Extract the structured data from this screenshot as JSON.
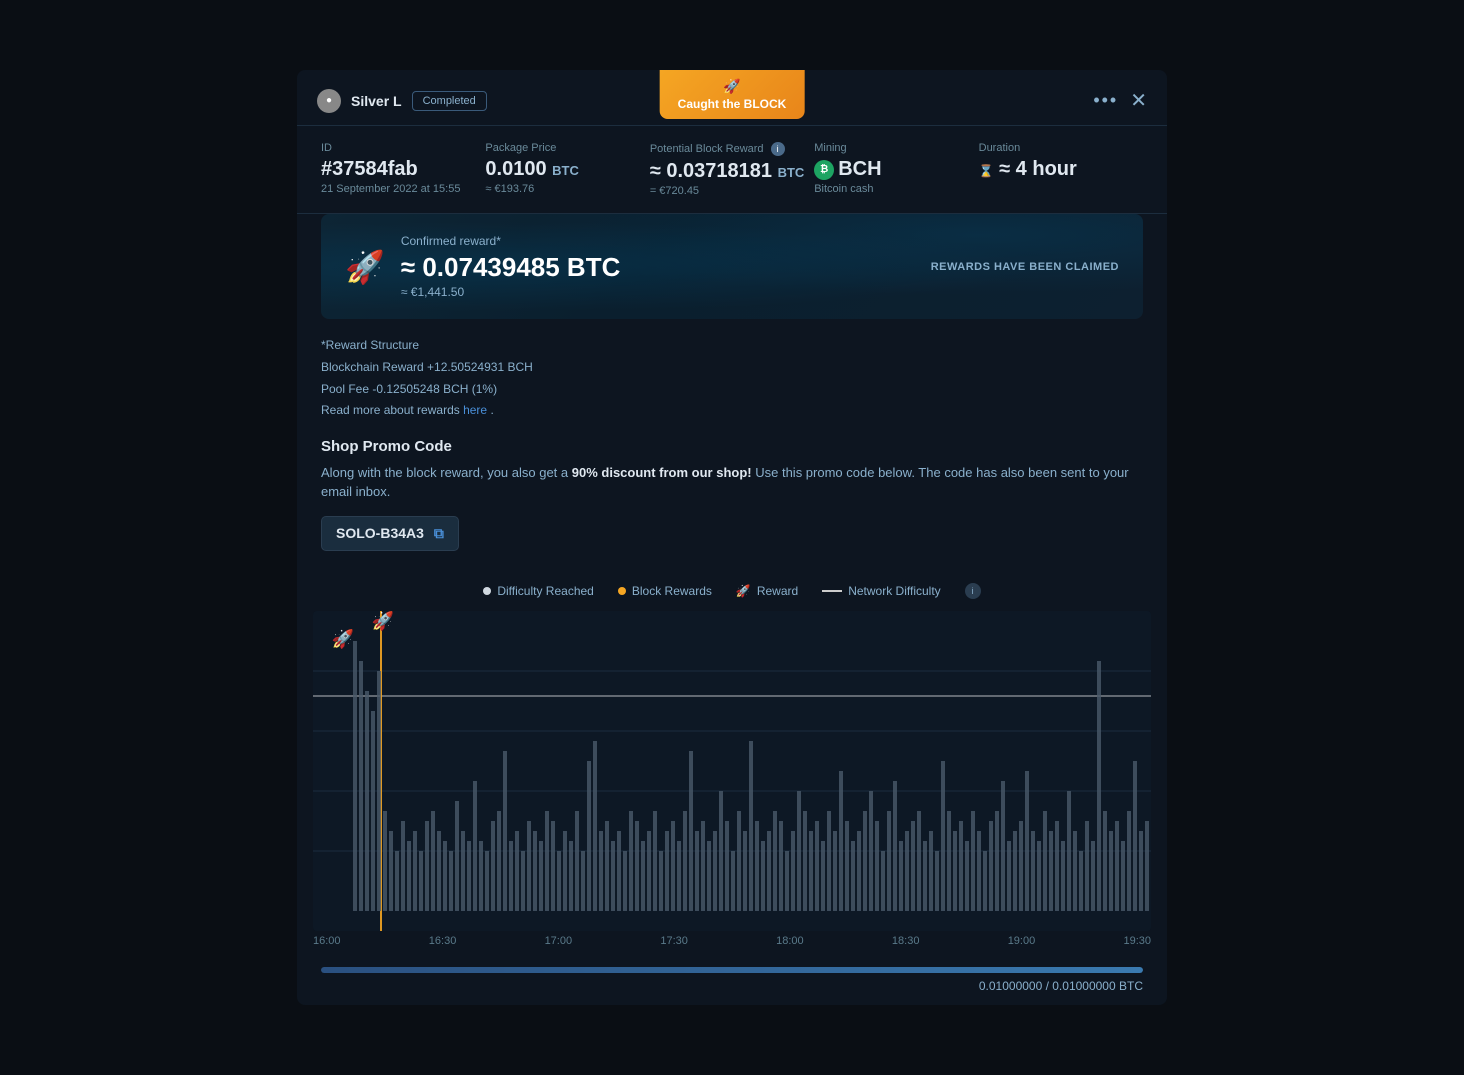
{
  "modal": {
    "caught_badge": "Caught the BLOCK",
    "rocket_emoji": "🚀",
    "user_name": "Silver L",
    "status": "Completed",
    "dots": "•••",
    "close": "✕"
  },
  "info": {
    "id_label": "ID",
    "id_value": "#37584fab",
    "date": "21 September 2022 at 15:55",
    "package_label": "Package Price",
    "package_value": "0.0100",
    "package_unit": "BTC",
    "package_eur": "≈ €193.76",
    "potential_label": "Potential Block Reward",
    "potential_value": "≈ 0.03718181",
    "potential_unit": "BTC",
    "potential_eur": "= €720.45",
    "mining_label": "Mining",
    "mining_coin": "BCH",
    "mining_sub": "Bitcoin cash",
    "duration_label": "Duration",
    "duration_value": "≈ 4 hour"
  },
  "reward_banner": {
    "confirmed_label": "Confirmed reward*",
    "confirmed_value": "≈ 0.07439485 BTC",
    "confirmed_eur": "≈ €1,441.50",
    "claimed_text": "REWARDS HAVE BEEN CLAIMED"
  },
  "reward_structure": {
    "title": "*Reward Structure",
    "blockchain": "Blockchain Reward +12.50524931 BCH",
    "pool_fee": "Pool Fee -0.12505248 BCH (1%)",
    "read_more_pre": "Read more about rewards ",
    "read_more_link": "here",
    "read_more_post": "."
  },
  "promo": {
    "title": "Shop Promo Code",
    "desc_pre": "Along with the block reward, you also get a ",
    "desc_bold": "90% discount from our shop!",
    "desc_post": " Use this promo code below. The code has also been sent to your email inbox.",
    "code": "SOLO-B34A3",
    "copy_icon": "⧉"
  },
  "legend": {
    "difficulty_reached": "Difficulty Reached",
    "block_rewards": "Block Rewards",
    "reward": "Reward",
    "network_difficulty": "Network Difficulty"
  },
  "chart": {
    "time_labels": [
      "16:00",
      "16:30",
      "17:00",
      "17:30",
      "18:00",
      "18:30",
      "19:00",
      "19:30"
    ]
  },
  "progress": {
    "value": "0.01000000 / 0.01000000 BTC",
    "percent": 100
  }
}
